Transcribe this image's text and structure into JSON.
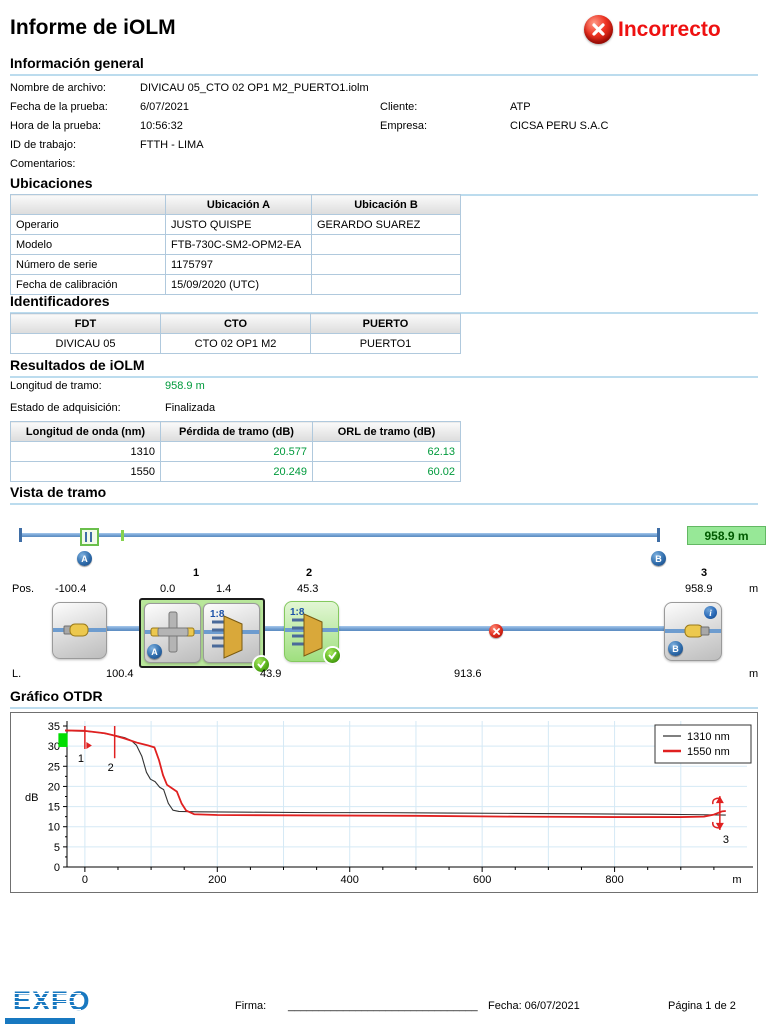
{
  "page": {
    "title": "Informe de iOLM",
    "status": "Incorrecto"
  },
  "general": {
    "heading": "Información general",
    "left_rows": [
      {
        "label": "Nombre de archivo:",
        "value": "DIVICAU 05_CTO 02 OP1 M2_PUERTO1.iolm"
      },
      {
        "label": "Fecha de la prueba:",
        "value": "6/07/2021"
      },
      {
        "label": "Hora de la prueba:",
        "value": "10:56:32"
      },
      {
        "label": "ID de trabajo:",
        "value": "FTTH - LIMA"
      },
      {
        "label": "Comentarios:",
        "value": ""
      }
    ],
    "right_rows": [
      {
        "label": "Cliente:",
        "value": "ATP"
      },
      {
        "label": "Empresa:",
        "value": "CICSA PERU S.A.C"
      }
    ]
  },
  "ubicaciones": {
    "heading": "Ubicaciones",
    "headers": [
      "",
      "Ubicación A",
      "Ubicación B"
    ],
    "rows": [
      [
        "Operario",
        "JUSTO QUISPE",
        "GERARDO SUAREZ"
      ],
      [
        "Modelo",
        "FTB-730C-SM2-OPM2-EA",
        ""
      ],
      [
        "Número de serie",
        "1175797",
        ""
      ],
      [
        "Fecha de calibración",
        "15/09/2020 (UTC)",
        ""
      ]
    ]
  },
  "identificadores": {
    "heading": "Identificadores",
    "headers": [
      "FDT",
      "CTO",
      "PUERTO"
    ],
    "rows": [
      [
        "DIVICAU 05",
        "CTO 02 OP1 M2",
        "PUERTO1"
      ]
    ]
  },
  "resultados": {
    "heading": "Resultados de iOLM",
    "fields": [
      {
        "label": "Longitud de tramo:",
        "value": "958.9 m"
      },
      {
        "label": "Estado de adquisición:",
        "value": "Finalizada"
      }
    ],
    "table": {
      "headers": [
        "Longitud de onda (nm)",
        "Pérdida de tramo (dB)",
        "ORL de tramo (dB)"
      ],
      "rows": [
        [
          "1310",
          "20.577",
          "62.13"
        ],
        [
          "1550",
          "20.249",
          "60.02"
        ]
      ]
    }
  },
  "vista": {
    "heading": "Vista de tramo",
    "length_badge": "958.9 m",
    "marker_a": "A",
    "marker_b": "B",
    "info_badge": "i",
    "splitter_label": "1:8",
    "pos_label": "Pos.",
    "l_label": "L.",
    "unit": "m",
    "event_numbers": [
      "1",
      "2",
      "3"
    ],
    "pos_values": [
      "-100.4",
      "0.0",
      "1.4",
      "45.3",
      "958.9"
    ],
    "l_values": [
      "100.4",
      "43.9",
      "913.6"
    ]
  },
  "grafico": {
    "heading": "Gráfico OTDR"
  },
  "chart_data": {
    "type": "line",
    "title": "Gráfico OTDR",
    "xlabel": "m",
    "ylabel": "dB",
    "xlim": [
      -27,
      1000
    ],
    "ylim": [
      0,
      35
    ],
    "x_ticks": [
      0,
      200,
      400,
      600,
      800
    ],
    "y_ticks": [
      0,
      5,
      10,
      15,
      20,
      25,
      30,
      35
    ],
    "grid": true,
    "legend_position": "top-right",
    "series": [
      {
        "name": "1310 nm",
        "color": "#333333",
        "width": 1.1,
        "points": [
          [
            -30,
            33.8
          ],
          [
            0,
            33.7
          ],
          [
            20,
            33.4
          ],
          [
            45,
            32.7
          ],
          [
            60,
            32.1
          ],
          [
            70,
            31.4
          ],
          [
            78,
            30.2
          ],
          [
            86,
            27.5
          ],
          [
            93,
            23.5
          ],
          [
            99,
            21.8
          ],
          [
            106,
            21.2
          ],
          [
            113,
            19.8
          ],
          [
            119,
            19.2
          ],
          [
            126,
            15.8
          ],
          [
            133,
            14.1
          ],
          [
            142,
            13.8
          ],
          [
            170,
            13.7
          ],
          [
            250,
            13.6
          ],
          [
            350,
            13.5
          ],
          [
            450,
            13.5
          ],
          [
            550,
            13.4
          ],
          [
            650,
            13.3
          ],
          [
            750,
            13.2
          ],
          [
            850,
            13.1
          ],
          [
            920,
            13.0
          ],
          [
            968,
            12.9
          ]
        ]
      },
      {
        "name": "1550 nm",
        "color": "#e02020",
        "width": 1.8,
        "points": [
          [
            -30,
            33.9
          ],
          [
            0,
            33.8
          ],
          [
            30,
            33.2
          ],
          [
            45,
            32.6
          ],
          [
            60,
            31.9
          ],
          [
            80,
            30.8
          ],
          [
            95,
            30.2
          ],
          [
            105,
            29.7
          ],
          [
            112,
            26.5
          ],
          [
            118,
            22.8
          ],
          [
            124,
            20.4
          ],
          [
            131,
            19.6
          ],
          [
            139,
            18.7
          ],
          [
            146,
            15.8
          ],
          [
            153,
            14.0
          ],
          [
            165,
            13.1
          ],
          [
            200,
            12.9
          ],
          [
            350,
            12.8
          ],
          [
            500,
            12.7
          ],
          [
            650,
            12.5
          ],
          [
            800,
            12.4
          ],
          [
            900,
            12.4
          ],
          [
            935,
            12.5
          ],
          [
            950,
            13.0
          ],
          [
            962,
            13.8
          ],
          [
            968,
            13.9
          ]
        ]
      }
    ],
    "markers": [
      {
        "label": "1",
        "x": 0,
        "y_top": 35,
        "y_bottom": 29.3,
        "arrow": "right"
      },
      {
        "label": "2",
        "x": 45,
        "y_top": 35,
        "y_bottom": 27,
        "arrow": "none"
      },
      {
        "label": "3",
        "x": 959,
        "y_top": 17.6,
        "y_bottom": 9.2,
        "arrow": "updown"
      }
    ],
    "start_marker": {
      "x": -40,
      "y": 33.2,
      "w": 14,
      "h": 3.4,
      "color": "#00dd00"
    },
    "colors": {
      "grid": "#d5e9f5",
      "axis": "#000000",
      "marker": "#e02020"
    }
  },
  "footer": {
    "brand": "EXFO",
    "firma_label": "Firma:",
    "firma_line": "_______________________________",
    "fecha": "Fecha: 06/07/2021",
    "pagina": "Página 1 de 2"
  }
}
